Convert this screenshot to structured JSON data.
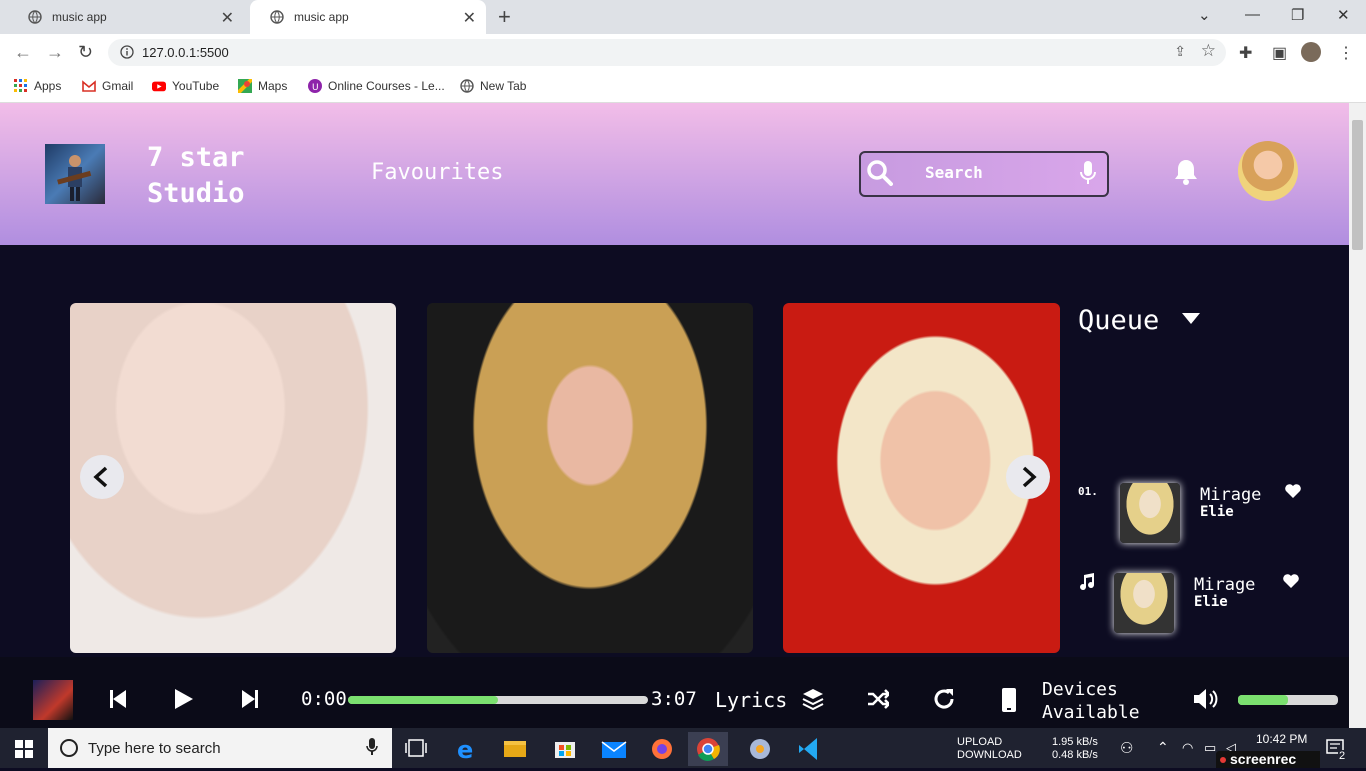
{
  "browser": {
    "tabs": [
      {
        "title": "music app",
        "active": false
      },
      {
        "title": "music app",
        "active": true
      }
    ],
    "url": "127.0.0.1:5500",
    "bookmarks": [
      "Apps",
      "Gmail",
      "YouTube",
      "Maps",
      "Online Courses - Le...",
      "New Tab"
    ]
  },
  "header": {
    "brand_line1": "7 star",
    "brand_line2": "Studio",
    "favourites_label": "Favourites",
    "search_placeholder": "Search"
  },
  "queue": {
    "title": "Queue",
    "items": [
      {
        "number": "01.",
        "title": "Mirage",
        "artist": "Elie",
        "icon": "heart-icon"
      },
      {
        "number": "",
        "title": "Mirage",
        "artist": "Elie",
        "icon": "heart-icon",
        "playing_icon": "music-note-icon"
      }
    ]
  },
  "player": {
    "current_time": "0:00",
    "total_time": "3:07",
    "progress_fraction": 0.5,
    "lyrics_label": "Lyrics",
    "devices_line1": "Devices",
    "devices_line2": "Available",
    "volume_fraction": 0.5
  },
  "taskbar": {
    "search_placeholder": "Type here to search",
    "upload_label": "UPLOAD",
    "download_label": "DOWNLOAD",
    "upload_speed": "1.95 kB/s",
    "download_speed": "0.48 kB/s",
    "time": "10:42 PM",
    "notification_count": "2",
    "watermark": "screenrec"
  },
  "colors": {
    "header_top": "#f2bde8",
    "header_bottom": "#b08ee0",
    "background": "#0d0c22",
    "progress_fill": "#7be06f"
  }
}
